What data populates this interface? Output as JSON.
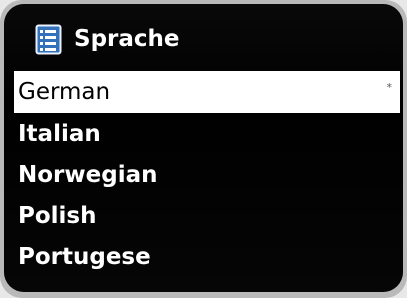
{
  "header": {
    "title": "Sprache",
    "icon": "list-menu-icon"
  },
  "language_list": {
    "items": [
      {
        "label": "German",
        "selected": true,
        "marker": "*"
      },
      {
        "label": "Italian",
        "selected": false
      },
      {
        "label": "Norwegian",
        "selected": false
      },
      {
        "label": "Polish",
        "selected": false
      },
      {
        "label": "Portugese",
        "selected": false
      }
    ]
  },
  "colors": {
    "screen_background": "#000000",
    "selected_background": "#ffffff",
    "text_primary": "#ffffff",
    "header_icon": "#2e6eb8"
  }
}
